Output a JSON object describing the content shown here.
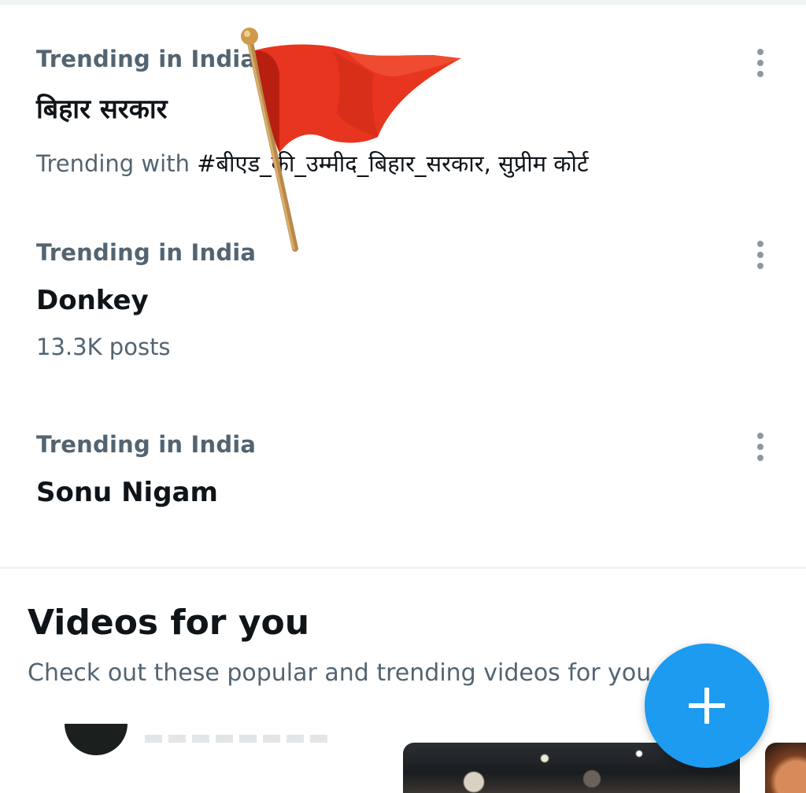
{
  "trends": [
    {
      "context": "Trending in India",
      "title": "बिहार सरकार",
      "meta_prefix": "Trending with ",
      "meta_tags": "#बीएड_की_उम्मीद_बिहार_सरकार, सुप्रीम कोर्ट"
    },
    {
      "context": "Trending in India",
      "title": "Donkey",
      "meta": "13.3K posts"
    },
    {
      "context": "Trending in India",
      "title": "Sonu Nigam"
    }
  ],
  "videos_section": {
    "title": "Videos for you",
    "subtitle": "Check out these popular and trending videos for you"
  },
  "icons": {
    "more": "more-vertical-icon",
    "compose": "plus-icon",
    "flag": "saffron-flag-emoji"
  },
  "colors": {
    "accent": "#1d9bf0",
    "text_primary": "#0f1419",
    "text_secondary": "#536471",
    "flag": "#e8351f"
  }
}
